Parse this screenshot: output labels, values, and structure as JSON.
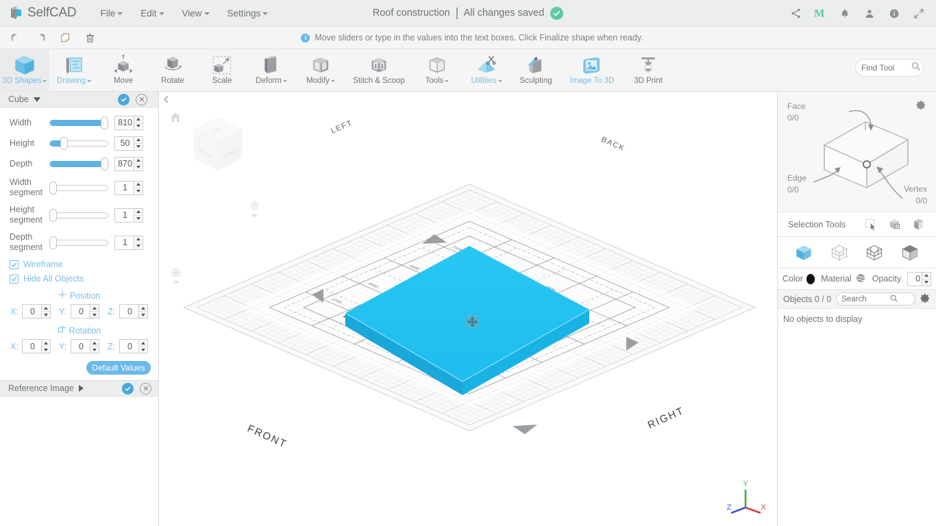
{
  "app": {
    "brand": "SelfCAD",
    "menu": [
      {
        "label": "File",
        "caret": true
      },
      {
        "label": "Edit",
        "caret": true
      },
      {
        "label": "View",
        "caret": true
      },
      {
        "label": "Settings",
        "caret": true
      }
    ],
    "document_title": "Roof construction",
    "save_status": "All changes saved",
    "save_icon": "check-circle-icon",
    "header_icons": [
      {
        "name": "share-icon",
        "glyph": "share"
      },
      {
        "name": "medium-logo-icon",
        "glyph": "M"
      },
      {
        "name": "notifications-bell-icon",
        "glyph": "bell"
      },
      {
        "name": "user-account-icon",
        "glyph": "person"
      },
      {
        "name": "info-icon",
        "glyph": "info"
      },
      {
        "name": "fullscreen-icon",
        "glyph": "expand"
      }
    ]
  },
  "subbar": {
    "undo": "undo-icon",
    "redo": "redo-icon",
    "copy": "copy-icon",
    "delete": "trash-icon",
    "hint": "Move sliders or type in the values into the text boxes. Click Finalize shape when ready."
  },
  "ribbon": {
    "tools": [
      {
        "label": "3D Shapes",
        "icon": "cube-icon",
        "caret": true,
        "active": true,
        "blue": true
      },
      {
        "label": "Drawing",
        "icon": "drawing-icon",
        "caret": true,
        "active": false,
        "blue": true
      },
      {
        "label": "Move",
        "icon": "move-icon",
        "caret": false,
        "active": false,
        "blue": false
      },
      {
        "label": "Rotate",
        "icon": "rotate-icon",
        "caret": false,
        "active": false,
        "blue": false
      },
      {
        "label": "Scale",
        "icon": "scale-icon",
        "caret": false,
        "active": false,
        "blue": false
      },
      {
        "label": "Deform",
        "icon": "deform-icon",
        "caret": true,
        "active": false,
        "blue": false
      },
      {
        "label": "Modify",
        "icon": "modify-icon",
        "caret": true,
        "active": false,
        "blue": false
      },
      {
        "label": "Stitch & Scoop",
        "icon": "stitch-scoop-icon",
        "caret": false,
        "active": false,
        "blue": false
      },
      {
        "label": "Tools",
        "icon": "tools-icon",
        "caret": true,
        "active": false,
        "blue": false
      },
      {
        "label": "Utilities",
        "icon": "utilities-icon",
        "caret": true,
        "active": false,
        "blue": true
      },
      {
        "label": "Sculpting",
        "icon": "sculpting-icon",
        "caret": false,
        "active": false,
        "blue": false
      },
      {
        "label": "Image To 3D",
        "icon": "image-to-3d-icon",
        "caret": false,
        "active": false,
        "blue": true
      },
      {
        "label": "3D Print",
        "icon": "3d-print-icon",
        "caret": false,
        "active": false,
        "blue": false
      }
    ],
    "find_tool_placeholder": "Find Tool",
    "find_tool_value": ""
  },
  "left_panel": {
    "title": "Cube",
    "sliders": [
      {
        "label": "Width",
        "value": "810",
        "fill_pct": 92,
        "name": "width"
      },
      {
        "label": "Height",
        "value": "50",
        "fill_pct": 22,
        "name": "height"
      },
      {
        "label": "Depth",
        "value": "870",
        "fill_pct": 92,
        "name": "depth"
      },
      {
        "label": "Width segment",
        "value": "1",
        "fill_pct": 0,
        "name": "width-segment"
      },
      {
        "label": "Height segment",
        "value": "1",
        "fill_pct": 0,
        "name": "height-segment"
      },
      {
        "label": "Depth segment",
        "value": "1",
        "fill_pct": 0,
        "name": "depth-segment"
      }
    ],
    "checkboxes": [
      {
        "label": "Wireframe",
        "checked": true,
        "name": "wireframe"
      },
      {
        "label": "Hide All Objects",
        "checked": true,
        "name": "hide-all-objects"
      }
    ],
    "position": {
      "label": "Position",
      "x": "0",
      "y": "0",
      "z": "0"
    },
    "rotation": {
      "label": "Rotation",
      "x": "0",
      "y": "0",
      "z": "0"
    },
    "axis_labels": {
      "x": "X:",
      "y": "Y:",
      "z": "Z:"
    },
    "default_values_button": "Default Values",
    "reference_image_title": "Reference Image"
  },
  "right_panel": {
    "selection_counts": [
      {
        "label": "Face",
        "value": "0/0"
      },
      {
        "label": "Edge",
        "value": "0/0"
      },
      {
        "label": "Vertex",
        "value": "0/0"
      }
    ],
    "settings_icon": "gear-icon",
    "selection_tools_label": "Selection Tools",
    "selection_tool_icons": [
      "rectangle-select-icon",
      "box-select-icon",
      "paint-select-icon"
    ],
    "mode_icons": [
      "object-mode-icon",
      "vertex-mode-icon",
      "edge-mode-icon",
      "face-mode-icon"
    ],
    "color_label": "Color",
    "color_value": "#111111",
    "material_label": "Material",
    "opacity_label": "Opacity",
    "opacity_value": "0",
    "objects_label": "Objects 0 / 0",
    "search_placeholder": "Search",
    "search_value": "",
    "empty_message": "No objects to display"
  },
  "viewport": {
    "collapse_icon": "chevron-left-icon",
    "home_icon": "home-icon",
    "globe_icon": "globe-icon",
    "camera_icon": "camera-icon",
    "nav_cube_faces": [
      "TOP",
      "RIGHT",
      "FRONT"
    ],
    "ground_labels": [
      {
        "text": "LEFT",
        "name": "viewport-label-left"
      },
      {
        "text": "BACK",
        "name": "viewport-label-back"
      },
      {
        "text": "FRONT",
        "name": "viewport-label-front"
      },
      {
        "text": "RIGHT",
        "name": "viewport-label-right"
      }
    ],
    "axis_labels": {
      "x": "X",
      "y": "Y",
      "z": "Z"
    },
    "axis_colors": {
      "x": "#e03b3b",
      "y": "#3fae3f",
      "z": "#3b53e0"
    },
    "object_color": "#22c0ef",
    "object_side_color": "#18aadd"
  }
}
